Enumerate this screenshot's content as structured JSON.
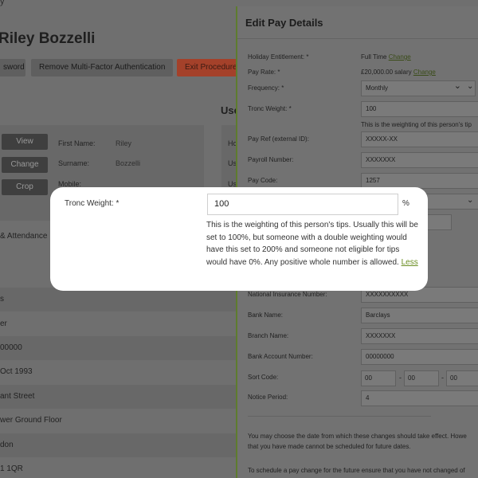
{
  "background": {
    "top_text": "y",
    "user_name": "Riley Bozzelli",
    "buttons": [
      "sword",
      "Remove Multi-Factor Authentication",
      "Exit Procedure"
    ],
    "section_heading": "Use",
    "photo_buttons": [
      "View",
      "Change",
      "Crop"
    ],
    "fields": [
      {
        "label": "First Name:",
        "value": "Riley"
      },
      {
        "label": "Surname:",
        "value": "Bozzelli"
      },
      {
        "label": "Mobile:",
        "value": ""
      }
    ],
    "right_labels": [
      "Ho",
      "Us",
      "Us"
    ],
    "tab_label": "& Attendance",
    "rows": [
      "s",
      "er",
      "00000",
      "Oct 1993",
      "ant Street",
      "wer Ground Floor",
      "don",
      "1 1QR"
    ]
  },
  "panel": {
    "title": "Edit Pay Details",
    "fields": {
      "holiday_label": "Holiday Entitlement: *",
      "holiday_value": "Full Time",
      "holiday_change": "Change",
      "pay_rate_label": "Pay Rate: *",
      "pay_rate_value": "£20,000.00 salary",
      "pay_rate_change": "Change",
      "frequency_label": "Frequency: *",
      "frequency_value": "Monthly",
      "tronc_label": "Tronc Weight: *",
      "tronc_value": "100",
      "tronc_hint": "This is the weighting of this person's tip",
      "pay_ref_label": "Pay Ref (external ID):",
      "pay_ref_value": "XXXXX-XX",
      "payroll_label": "Payroll Number:",
      "payroll_value": "XXXXXXX",
      "pay_code_label": "Pay Code:",
      "pay_code_value": "1257",
      "ni_label": "National Insurance Number:",
      "ni_value": "XXXXXXXXXX",
      "bank_label": "Bank Name:",
      "bank_value": "Barclays",
      "branch_label": "Branch Name:",
      "branch_value": "XXXXXXX",
      "account_label": "Bank Account Number:",
      "account_value": "00000000",
      "sort_label": "Sort Code:",
      "sort_values": [
        "00",
        "00",
        "00"
      ],
      "notice_label": "Notice Period:",
      "notice_value": "4"
    },
    "para1_line1": "You may choose the date from which these changes should take effect. Howe",
    "para1_line2": "that you have made cannot be scheduled for future dates.",
    "para2_line1": "To schedule a pay change for the future ensure that you have not changed of"
  },
  "focus_card": {
    "label": "Tronc Weight: *",
    "value": "100",
    "unit": "%",
    "description": "This is the weighting of this person's tips. Usually this will be set to 100%, but someone with a double weighting would have this set to 200% and someone not eligible for tips would have 0%. Any positive whole number is allowed.",
    "less_link": "Less"
  }
}
